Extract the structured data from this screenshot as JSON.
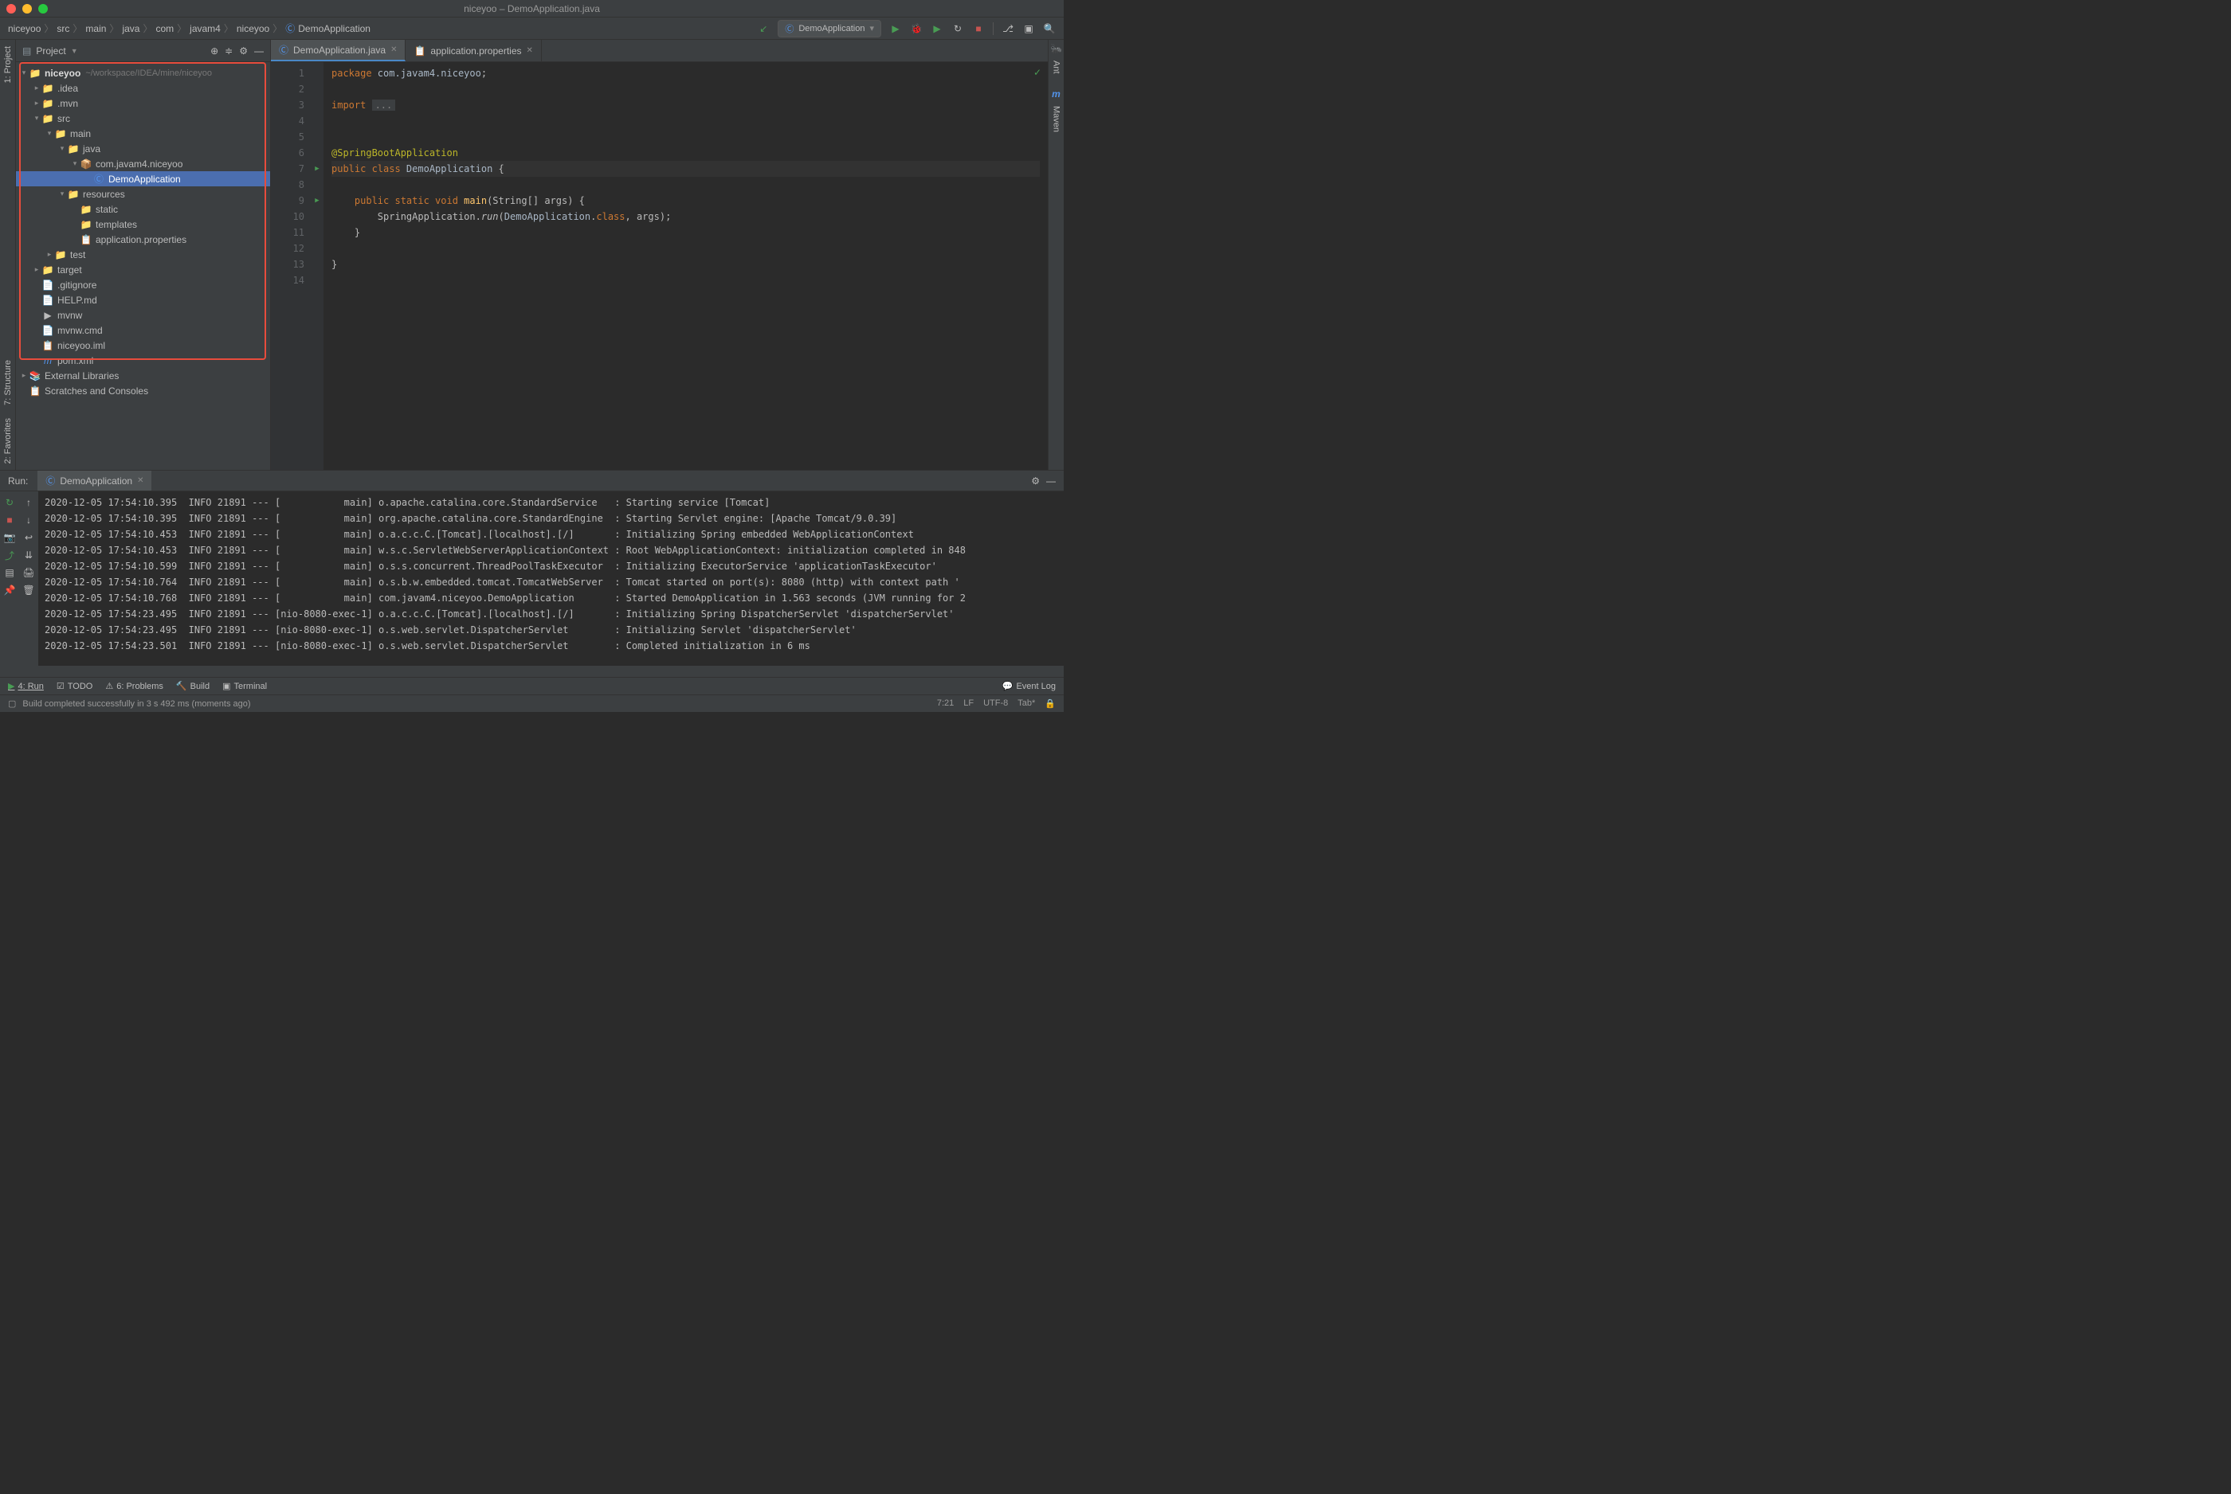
{
  "titlebar": {
    "title": "niceyoo – DemoApplication.java"
  },
  "breadcrumbs": [
    "niceyoo",
    "src",
    "main",
    "java",
    "com",
    "javam4",
    "niceyoo",
    "DemoApplication"
  ],
  "runConfig": {
    "name": "DemoApplication"
  },
  "projectPanel": {
    "title": "Project"
  },
  "tree": {
    "root": {
      "name": "niceyoo",
      "path": "~/workspace/IDEA/mine/niceyoo"
    },
    "idea": ".idea",
    "mvn": ".mvn",
    "src": "src",
    "main": "main",
    "java": "java",
    "pkg": "com.javam4.niceyoo",
    "demoapp": "DemoApplication",
    "resources": "resources",
    "static": "static",
    "templates": "templates",
    "appprops": "application.properties",
    "test": "test",
    "target": "target",
    "gitignore": ".gitignore",
    "help": "HELP.md",
    "mvnw": "mvnw",
    "mvnwcmd": "mvnw.cmd",
    "iml": "niceyoo.iml",
    "pom": "pom.xml",
    "extlib": "External Libraries",
    "scratch": "Scratches and Consoles"
  },
  "tabs": {
    "tab1": "DemoApplication.java",
    "tab2": "application.properties"
  },
  "code": {
    "l1a": "package ",
    "l1b": "com.javam4.niceyoo",
    "l1c": ";",
    "l3a": "import ",
    "l3b": "...",
    "l6": "@SpringBootApplication",
    "l7a": "public class ",
    "l7b": "DemoApplication",
    "l7c": " {",
    "l9a": "    public static void ",
    "l9b": "main",
    "l9c": "(String[] args) {",
    "l10a": "        SpringApplication.",
    "l10b": "run",
    "l10c": "(",
    "l10d": "DemoApplication",
    "l10e": ".",
    "l10f": "class",
    "l10g": ", args);",
    "l11": "    }",
    "l13": "}"
  },
  "lineNumbers": [
    "1",
    "2",
    "3",
    "4",
    "5",
    "6",
    "7",
    "8",
    "9",
    "10",
    "11",
    "12",
    "13",
    "14"
  ],
  "runPanel": {
    "title": "Run:",
    "tab": "DemoApplication",
    "logs": [
      "2020-12-05 17:54:10.395  INFO 21891 --- [           main] o.apache.catalina.core.StandardService   : Starting service [Tomcat]",
      "2020-12-05 17:54:10.395  INFO 21891 --- [           main] org.apache.catalina.core.StandardEngine  : Starting Servlet engine: [Apache Tomcat/9.0.39]",
      "2020-12-05 17:54:10.453  INFO 21891 --- [           main] o.a.c.c.C.[Tomcat].[localhost].[/]       : Initializing Spring embedded WebApplicationContext",
      "2020-12-05 17:54:10.453  INFO 21891 --- [           main] w.s.c.ServletWebServerApplicationContext : Root WebApplicationContext: initialization completed in 848",
      "2020-12-05 17:54:10.599  INFO 21891 --- [           main] o.s.s.concurrent.ThreadPoolTaskExecutor  : Initializing ExecutorService 'applicationTaskExecutor'",
      "2020-12-05 17:54:10.764  INFO 21891 --- [           main] o.s.b.w.embedded.tomcat.TomcatWebServer  : Tomcat started on port(s): 8080 (http) with context path '",
      "2020-12-05 17:54:10.768  INFO 21891 --- [           main] com.javam4.niceyoo.DemoApplication       : Started DemoApplication in 1.563 seconds (JVM running for 2",
      "2020-12-05 17:54:23.495  INFO 21891 --- [nio-8080-exec-1] o.a.c.c.C.[Tomcat].[localhost].[/]       : Initializing Spring DispatcherServlet 'dispatcherServlet'",
      "2020-12-05 17:54:23.495  INFO 21891 --- [nio-8080-exec-1] o.s.web.servlet.DispatcherServlet        : Initializing Servlet 'dispatcherServlet'",
      "2020-12-05 17:54:23.501  INFO 21891 --- [nio-8080-exec-1] o.s.web.servlet.DispatcherServlet        : Completed initialization in 6 ms"
    ]
  },
  "bottomTabs": {
    "run": "4: Run",
    "todo": "TODO",
    "problems": "6: Problems",
    "build": "Build",
    "terminal": "Terminal",
    "eventlog": "Event Log"
  },
  "status": {
    "msg": "Build completed successfully in 3 s 492 ms (moments ago)",
    "pos": "7:21",
    "lf": "LF",
    "enc": "UTF-8",
    "tab": "Tab*"
  },
  "leftGutter": {
    "project": "1: Project",
    "structure": "7: Structure",
    "favorites": "2: Favorites"
  },
  "rightGutter": {
    "ant": "Ant",
    "maven": "Maven"
  }
}
